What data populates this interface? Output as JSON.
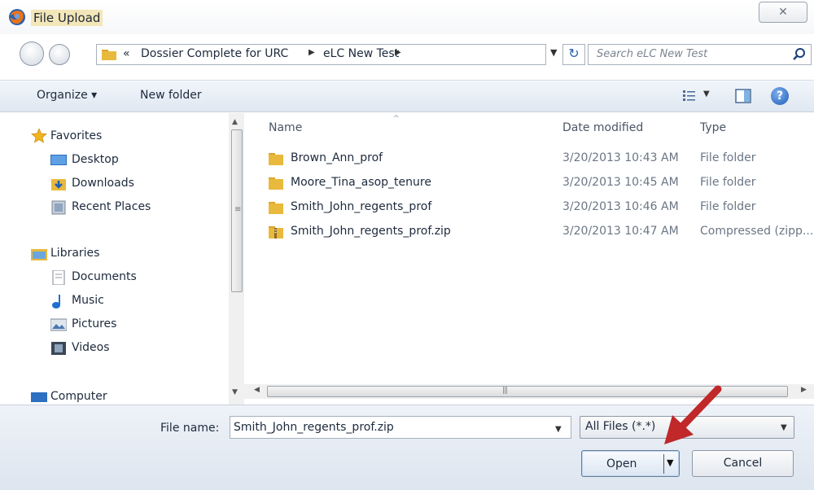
{
  "window": {
    "title": "File Upload",
    "close_symbol": "✕",
    "app_icon": "firefox-icon"
  },
  "address": {
    "overflow_symbol": "«",
    "breadcrumbs": [
      "Dossier Complete for URC",
      "eLC New Test"
    ],
    "refresh_symbol": "↻"
  },
  "search": {
    "placeholder": "Search eLC New Test"
  },
  "toolbar": {
    "organize_label": "Organize ▾",
    "new_folder_label": "New folder",
    "help_symbol": "?"
  },
  "navigation": {
    "favorites": {
      "label": "Favorites",
      "items": [
        "Desktop",
        "Downloads",
        "Recent Places"
      ]
    },
    "libraries": {
      "label": "Libraries",
      "items": [
        "Documents",
        "Music",
        "Pictures",
        "Videos"
      ]
    },
    "computer_label": "Computer"
  },
  "file_list": {
    "columns": {
      "name": "Name",
      "date_modified": "Date modified",
      "type": "Type"
    },
    "files": [
      {
        "name": "Brown_Ann_prof",
        "date": "3/20/2013 10:43 AM",
        "type": "File folder",
        "icon": "folder-icon"
      },
      {
        "name": "Moore_Tina_asop_tenure",
        "date": "3/20/2013 10:45 AM",
        "type": "File folder",
        "icon": "folder-icon"
      },
      {
        "name": "Smith_John_regents_prof",
        "date": "3/20/2013 10:46 AM",
        "type": "File folder",
        "icon": "folder-icon"
      },
      {
        "name": "Smith_John_regents_prof.zip",
        "date": "3/20/2013 10:47 AM",
        "type": "Compressed (zipp...",
        "icon": "zip-folder-icon"
      }
    ]
  },
  "bottom": {
    "file_name_label": "File name:",
    "file_name_value": "Smith_John_regents_prof.zip",
    "filter_value": "All Files (*.*)",
    "open_label": "Open",
    "cancel_label": "Cancel"
  },
  "colors": {
    "toolbar_bg": "#dfe7f1",
    "folder_yellow": "#e8b93c",
    "annotation_red": "#c0282a",
    "accent_blue": "#1f5fb5"
  }
}
